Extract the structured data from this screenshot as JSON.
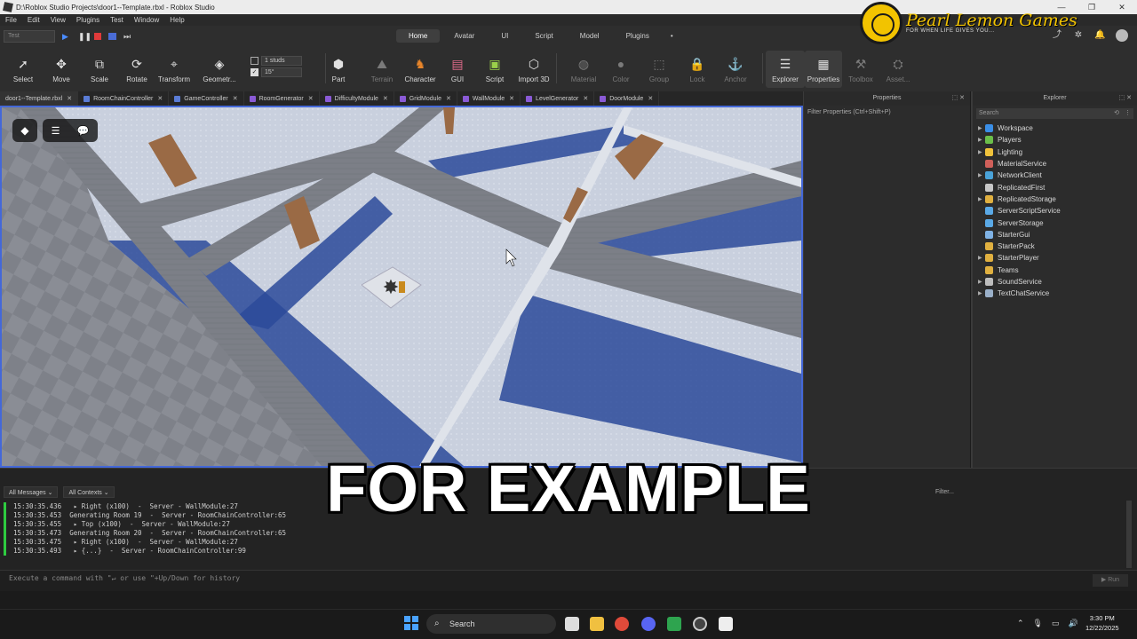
{
  "window": {
    "title": "D:\\Roblox Studio Projects\\door1--Template.rbxl - Roblox Studio",
    "controls": [
      "—",
      "❐",
      "✕"
    ]
  },
  "brand": {
    "name": "Pearl Lemon Games",
    "tagline": "FOR WHEN LIFE GIVES YOU..."
  },
  "menu": [
    "File",
    "Edit",
    "View",
    "Plugins",
    "Test",
    "Window",
    "Help"
  ],
  "play_mode": "Test",
  "ribbon_tabs": [
    {
      "label": "Home",
      "active": true
    },
    {
      "label": "Avatar"
    },
    {
      "label": "UI"
    },
    {
      "label": "Script"
    },
    {
      "label": "Model"
    },
    {
      "label": "Plugins"
    },
    {
      "label": "•"
    }
  ],
  "toolbar": {
    "select": "Select",
    "move": "Move",
    "scale": "Scale",
    "rotate": "Rotate",
    "transform": "Transform",
    "geometry": "Geometr...",
    "studs_value": "1 studs",
    "angle_value": "15°",
    "part": "Part",
    "terrain": "Terrain",
    "character": "Character",
    "gui": "GUI",
    "script": "Script",
    "import3d": "Import 3D",
    "material": "Material",
    "color": "Color",
    "group": "Group",
    "lock": "Lock",
    "anchor": "Anchor",
    "explorer": "Explorer",
    "properties": "Properties",
    "toolbox": "Toolbox",
    "asset": "Asset..."
  },
  "doc_tabs": [
    {
      "label": "door1--Template.rbxl",
      "active": true
    },
    {
      "label": "RoomChainController"
    },
    {
      "label": "GameController"
    },
    {
      "label": "RoomGenerator"
    },
    {
      "label": "DifficultyModule"
    },
    {
      "label": "GridModule"
    },
    {
      "label": "WallModule"
    },
    {
      "label": "LevelGenerator"
    },
    {
      "label": "DoorModule"
    }
  ],
  "properties_panel": {
    "title": "Properties",
    "filter_placeholder": "Filter Properties (Ctrl+Shift+P)"
  },
  "explorer_panel": {
    "title": "Explorer",
    "search_placeholder": "Search",
    "items": [
      {
        "label": "Workspace",
        "expandable": true,
        "color": "#3a8ee6"
      },
      {
        "label": "Players",
        "expandable": true,
        "color": "#6bbf4a"
      },
      {
        "label": "Lighting",
        "expandable": true,
        "color": "#f0c23b"
      },
      {
        "label": "MaterialService",
        "expandable": false,
        "color": "#d0605a"
      },
      {
        "label": "NetworkClient",
        "expandable": true,
        "color": "#4aa3d9"
      },
      {
        "label": "ReplicatedFirst",
        "expandable": false,
        "color": "#c8c8c8"
      },
      {
        "label": "ReplicatedStorage",
        "expandable": true,
        "color": "#e0b040"
      },
      {
        "label": "ServerScriptService",
        "expandable": false,
        "color": "#5aa9e6"
      },
      {
        "label": "ServerStorage",
        "expandable": false,
        "color": "#5aa9e6"
      },
      {
        "label": "StarterGui",
        "expandable": false,
        "color": "#7fb2e5"
      },
      {
        "label": "StarterPack",
        "expandable": false,
        "color": "#e0b040"
      },
      {
        "label": "StarterPlayer",
        "expandable": true,
        "color": "#e0b040"
      },
      {
        "label": "Teams",
        "expandable": false,
        "color": "#e0b040"
      },
      {
        "label": "SoundService",
        "expandable": true,
        "color": "#bdbdbd"
      },
      {
        "label": "TextChatService",
        "expandable": true,
        "color": "#9ab0c9"
      }
    ]
  },
  "output": {
    "filter_messages": "All Messages",
    "filter_contexts": "All Contexts",
    "filter_placeholder": "Filter...",
    "lines": [
      "15:30:35.436   ▸ Right (x100)  -  Server - WallModule:27",
      "15:30:35.453  Generating Room 19  -  Server - RoomChainController:65",
      "15:30:35.455   ▸ Top (x100)  -  Server - WallModule:27",
      "15:30:35.473  Generating Room 20  -  Server - RoomChainController:65",
      "15:30:35.475   ▸ Right (x100)  -  Server - WallModule:27",
      "15:30:35.493   ▸ {...}  -  Server - RoomChainController:99"
    ]
  },
  "command_bar": {
    "placeholder": "Execute a command with \"↵ or use \"+Up/Down for history",
    "run_label": "▶ Run"
  },
  "caption": "FOR EXAMPLE",
  "taskbar": {
    "search_label": "Search",
    "time": "3:30 PM",
    "date": "12/22/2025"
  }
}
